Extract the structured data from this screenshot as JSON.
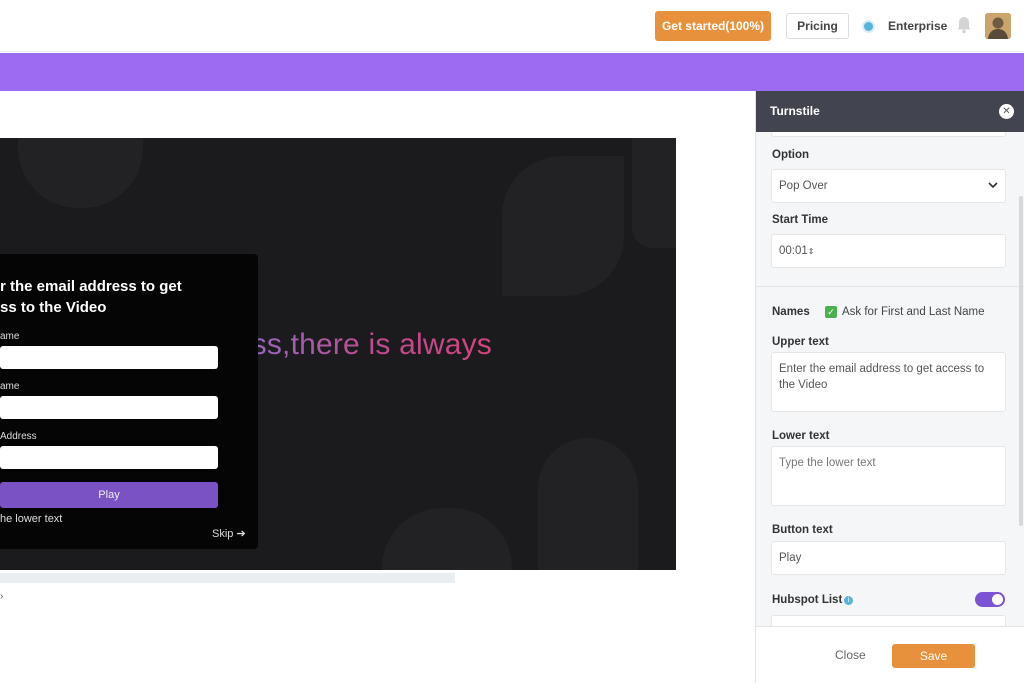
{
  "topbar": {
    "get_started": "Get started(100%)",
    "pricing": "Pricing",
    "enterprise": "Enterprise"
  },
  "video": {
    "overlay_text": "For every business,there is always",
    "popup": {
      "title": "r the email address to get\nss to the Video",
      "label_first": "ame",
      "label_last": "ame",
      "label_email": "Address",
      "play": "Play",
      "lower_text": "he lower text",
      "skip": "Skip"
    }
  },
  "panel": {
    "title": "Turnstile",
    "option_label": "Option",
    "option_value": "Pop Over",
    "start_time_label": "Start Time",
    "start_time_value": "00:01",
    "names_label": "Names",
    "names_checkbox": "Ask for First and Last Name",
    "upper_text_label": "Upper text",
    "upper_text_value": "Enter the email address to get access to the Video",
    "lower_text_label": "Lower text",
    "lower_text_placeholder": "Type the lower text",
    "button_text_label": "Button text",
    "button_text_value": "Play",
    "hubspot_label": "Hubspot List",
    "close": "Close",
    "save": "Save"
  },
  "colors": {
    "accent_orange": "#e8913c",
    "brand_purple": "#9b6bf2",
    "toggle_purple": "#7b53d4",
    "panel_header": "#42454f"
  }
}
